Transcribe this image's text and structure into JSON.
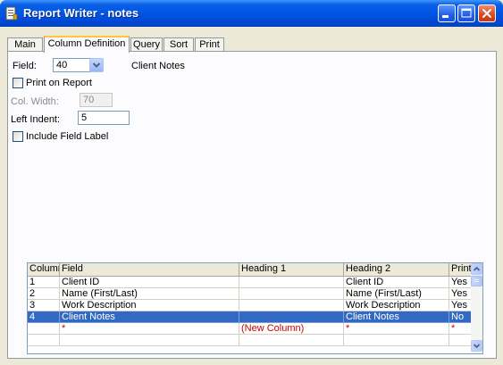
{
  "window": {
    "title": "Report Writer - notes"
  },
  "tabs": [
    {
      "label": "Main"
    },
    {
      "label": "Column Definition"
    },
    {
      "label": "Query"
    },
    {
      "label": "Sort"
    },
    {
      "label": "Print"
    }
  ],
  "form": {
    "field_label": "Field:",
    "field_value": "40",
    "field_name": "Client Notes",
    "print_on_report_label": "Print on Report",
    "print_on_report_checked": false,
    "col_width_label": "Col. Width:",
    "col_width_value": "70",
    "left_indent_label": "Left Indent:",
    "left_indent_value": "5",
    "include_field_label_label": "Include Field Label",
    "include_field_label_checked": false
  },
  "grid": {
    "columns": [
      "Column",
      "Field",
      "Heading 1",
      "Heading 2",
      "Print"
    ],
    "rows": [
      {
        "column": "1",
        "field": "Client ID",
        "heading1": "",
        "heading2": "Client ID",
        "print": "Yes"
      },
      {
        "column": "2",
        "field": "Name (First/Last)",
        "heading1": "",
        "heading2": "Name (First/Last)",
        "print": "Yes"
      },
      {
        "column": "3",
        "field": "Work Description",
        "heading1": "",
        "heading2": "Work Description",
        "print": "Yes"
      },
      {
        "column": "4",
        "field": "Client Notes",
        "heading1": "",
        "heading2": "Client Notes",
        "print": "No",
        "selected": true
      }
    ],
    "new_row": {
      "column": "",
      "field": "*",
      "heading1": "(New Column)",
      "heading2": "*",
      "print": "*"
    }
  },
  "colors": {
    "titlebar": "#0055e5",
    "selection": "#316ac5",
    "new_row_text": "#cc0000",
    "active_tab_accent": "#ffc73c"
  }
}
